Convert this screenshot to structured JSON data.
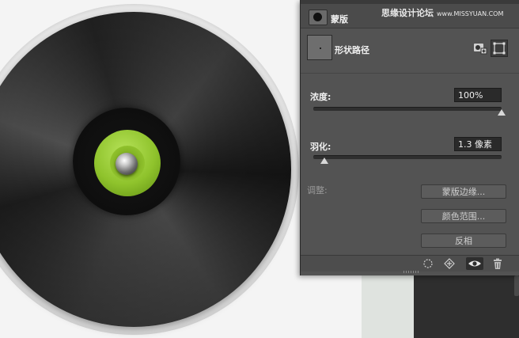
{
  "panel": {
    "tab_title": "蒙版",
    "vector_mask_label": "形状路径",
    "density_label": "浓度:",
    "density_value": "100%",
    "density_fraction": 1.0,
    "feather_label": "羽化:",
    "feather_value": "1.3 像素",
    "feather_fraction": 0.06,
    "refine_label": "调整:",
    "buttons": {
      "mask_edge": "蒙版边缘...",
      "color_range": "颜色范围...",
      "invert": "反相"
    }
  },
  "watermark": {
    "cn": "思缘设计论坛",
    "url": "www.MISSYUAN.COM"
  },
  "icons": {
    "add_mask": "add-pixel-mask-icon",
    "select_vector": "select-vector-mask-icon",
    "load_selection": "load-selection-icon",
    "apply_mask": "apply-mask-icon",
    "toggle_visibility": "eye-icon",
    "delete_mask": "trash-icon"
  },
  "colors": {
    "panel_bg": "#535353",
    "disc": "#1e1e1e",
    "label_green": "#8fc32c"
  }
}
